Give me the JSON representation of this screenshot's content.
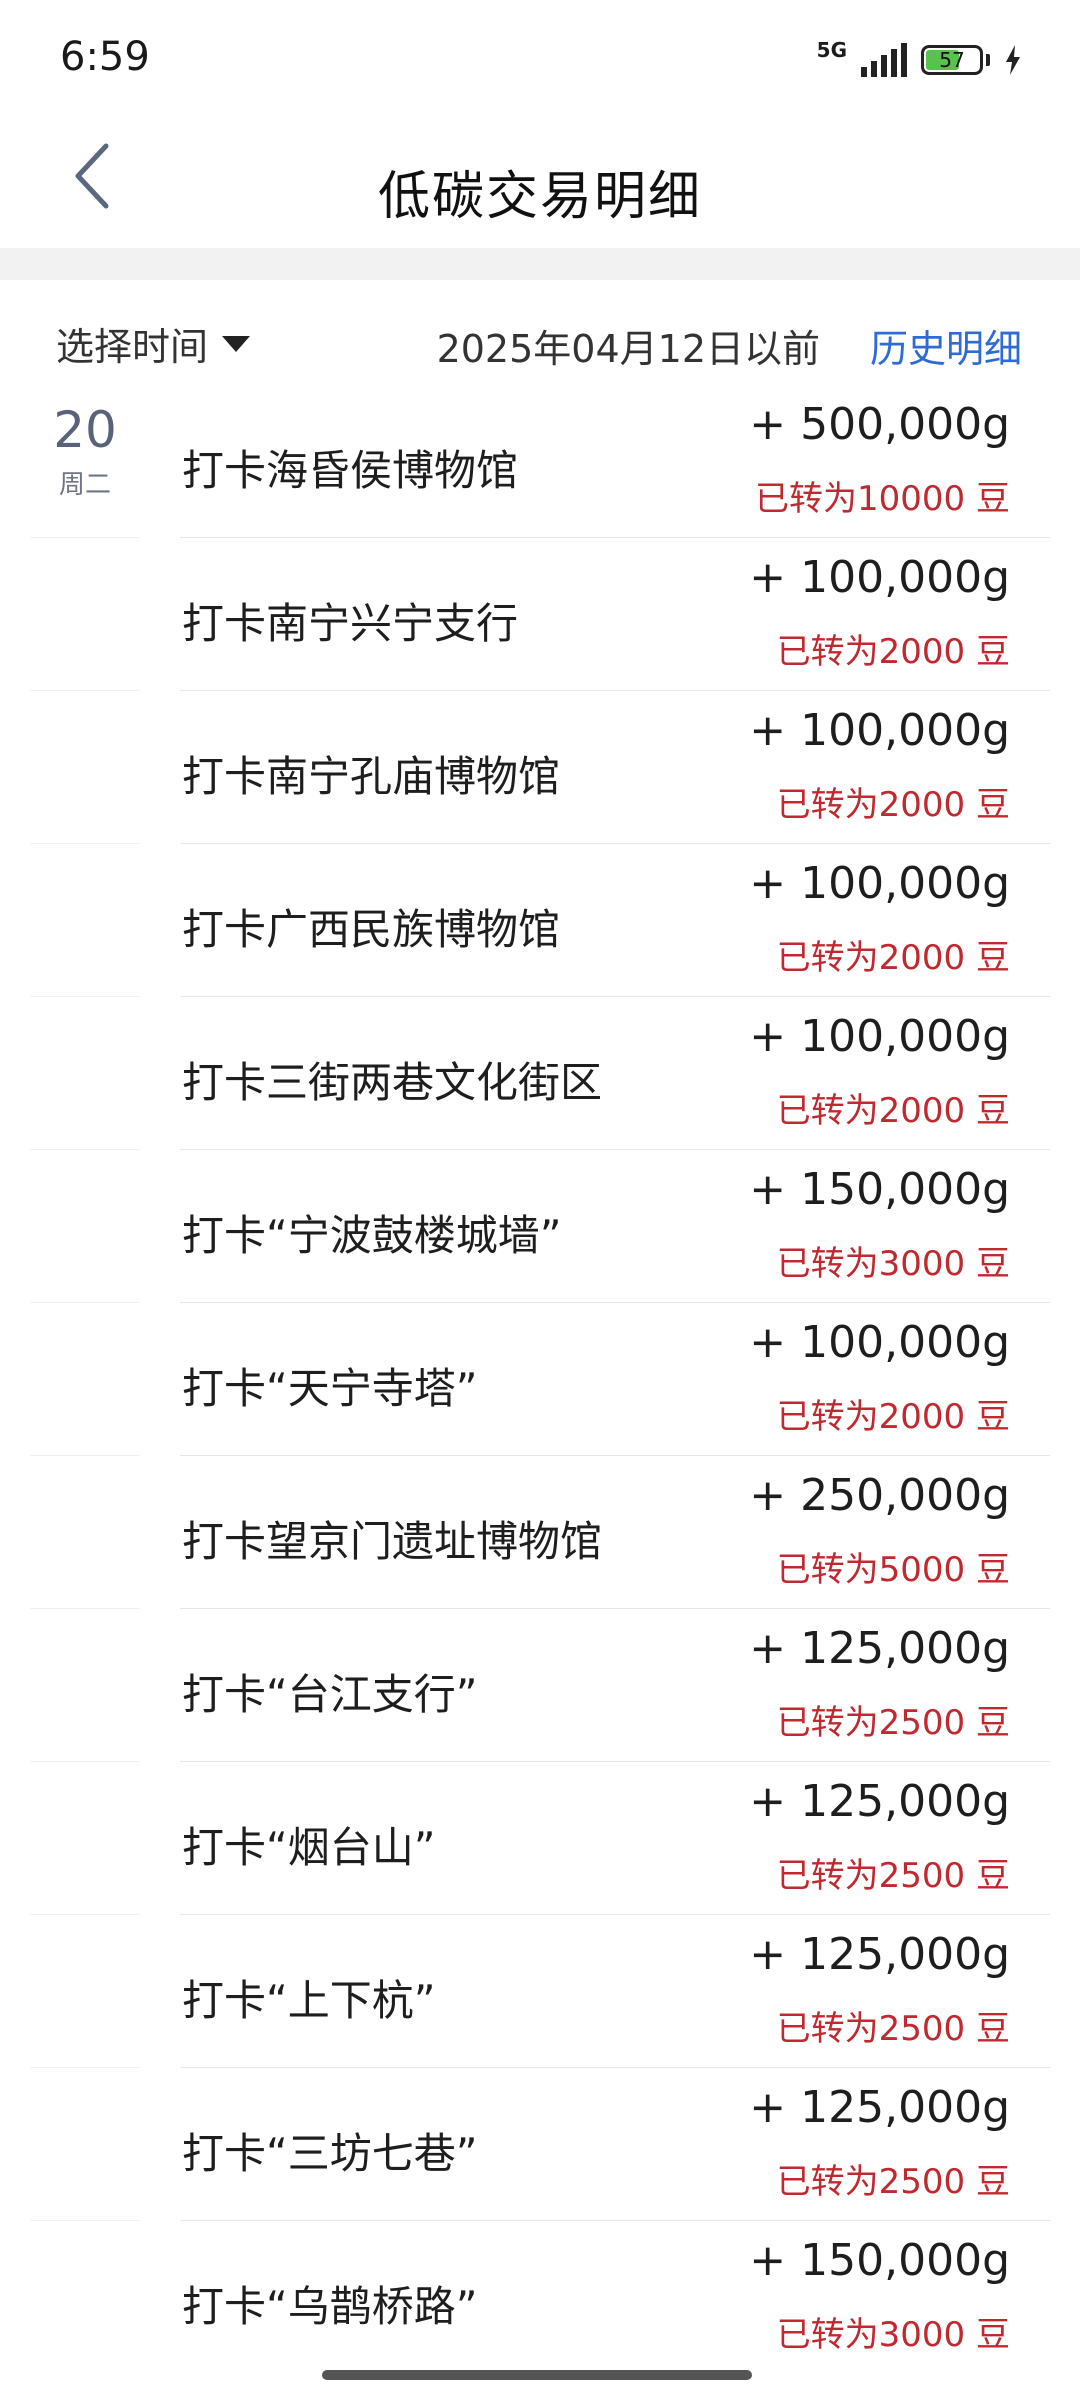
{
  "status_bar": {
    "time": "6:59",
    "network": "5G",
    "battery_level": "57"
  },
  "header": {
    "title": "低碳交易明细"
  },
  "filter": {
    "select_time_label": "选择时间",
    "date_info": "2025年04月12日以前",
    "history_link": "历史明细"
  },
  "day": {
    "number": "20",
    "weekday": "周二"
  },
  "transactions": [
    {
      "title": "打卡海昏侯博物馆",
      "amount": "+ 500,000g",
      "note": "已转为10000 豆"
    },
    {
      "title": "打卡南宁兴宁支行",
      "amount": "+ 100,000g",
      "note": "已转为2000 豆"
    },
    {
      "title": "打卡南宁孔庙博物馆",
      "amount": "+ 100,000g",
      "note": "已转为2000 豆"
    },
    {
      "title": "打卡广西民族博物馆",
      "amount": "+ 100,000g",
      "note": "已转为2000 豆"
    },
    {
      "title": "打卡三街两巷文化街区",
      "amount": "+ 100,000g",
      "note": "已转为2000 豆"
    },
    {
      "title": "打卡“宁波鼓楼城墙”",
      "amount": "+ 150,000g",
      "note": "已转为3000 豆"
    },
    {
      "title": "打卡“天宁寺塔”",
      "amount": "+ 100,000g",
      "note": "已转为2000 豆"
    },
    {
      "title": "打卡望京门遗址博物馆",
      "amount": "+ 250,000g",
      "note": "已转为5000 豆"
    },
    {
      "title": "打卡“台江支行”",
      "amount": "+ 125,000g",
      "note": "已转为2500 豆"
    },
    {
      "title": "打卡“烟台山”",
      "amount": "+ 125,000g",
      "note": "已转为2500 豆"
    },
    {
      "title": "打卡“上下杭”",
      "amount": "+ 125,000g",
      "note": "已转为2500 豆"
    },
    {
      "title": "打卡“三坊七巷”",
      "amount": "+ 125,000g",
      "note": "已转为2500 豆"
    },
    {
      "title": "打卡“乌鹊桥路”",
      "amount": "+ 150,000g",
      "note": "已转为3000 豆"
    }
  ],
  "icons": {
    "back": "chevron-left-icon",
    "dropdown": "caret-down-icon",
    "signal": "signal-bars-icon",
    "battery": "battery-icon",
    "charging": "lightning-icon"
  },
  "colors": {
    "link": "#2f6bd6",
    "note_red": "#c0292f",
    "day_gray": "#58627a"
  }
}
